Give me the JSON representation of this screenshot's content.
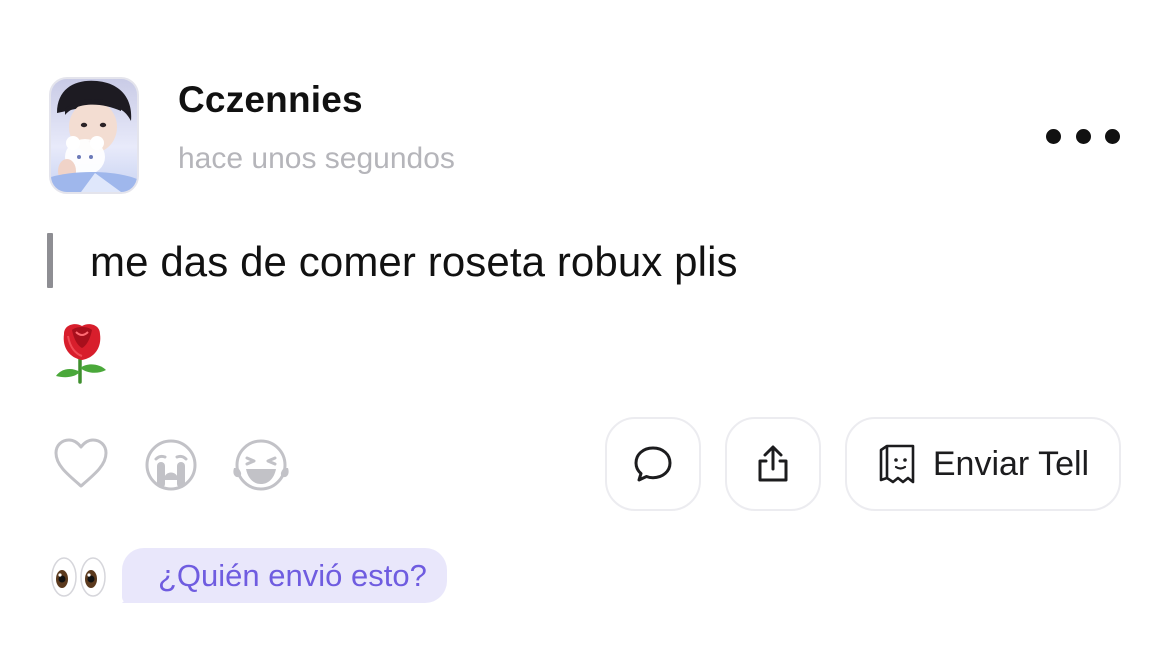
{
  "post": {
    "username": "Cczennies",
    "timestamp": "hace unos segundos",
    "message": "me das de comer roseta robux plis",
    "attached_emoji": "rose-emoji"
  },
  "reactions": [
    {
      "icon": "heart-outline-icon"
    },
    {
      "icon": "crying-face-icon"
    },
    {
      "icon": "laughing-tears-face-icon"
    }
  ],
  "actions": {
    "comment_icon": "speech-bubble-icon",
    "share_icon": "share-upload-icon",
    "send_icon": "tell-bag-icon",
    "send_label": "Enviar Tell"
  },
  "who_sent": {
    "icon": "eyes-emoji",
    "label": "¿Quién envió esto?"
  },
  "colors": {
    "accent_purple": "#6f5ce0",
    "bubble_bg": "#e9e7fb",
    "muted_text": "#b5b5ba",
    "icon_gray": "#c2c2c7",
    "rose_red": "#d81e2c"
  }
}
